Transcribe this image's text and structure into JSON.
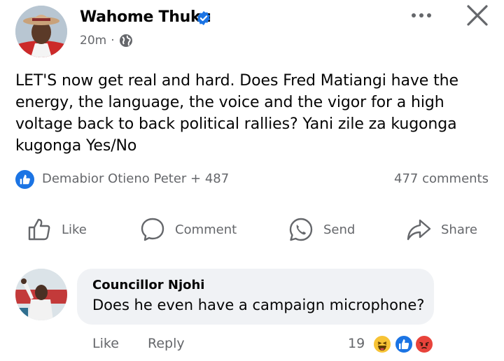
{
  "post": {
    "author": "Wahome Thuku",
    "time": "20m",
    "separator": "·",
    "text": "LET'S now get real and hard. Does Fred Matiangi have the energy, the language, the voice and the vigor for a high voltage back to back political rallies? Yani zile za kugonga kugonga Yes/No",
    "verified_icon": "verified-badge-icon",
    "privacy_icon": "globe-icon"
  },
  "stats": {
    "reactors": "Demabior Otieno Peter + 487",
    "comments": "477 comments"
  },
  "actions": {
    "like": "Like",
    "comment": "Comment",
    "send": "Send",
    "share": "Share"
  },
  "comment": {
    "author": "Councillor Njohi",
    "text": "Does he even have a campaign microphone?",
    "like": "Like",
    "reply": "Reply",
    "reaction_count": "19",
    "reactions": [
      "haha",
      "like",
      "angry"
    ]
  },
  "colors": {
    "accent": "#1b74e4",
    "secondary_text": "#65676b",
    "bubble": "#f0f2f5"
  }
}
